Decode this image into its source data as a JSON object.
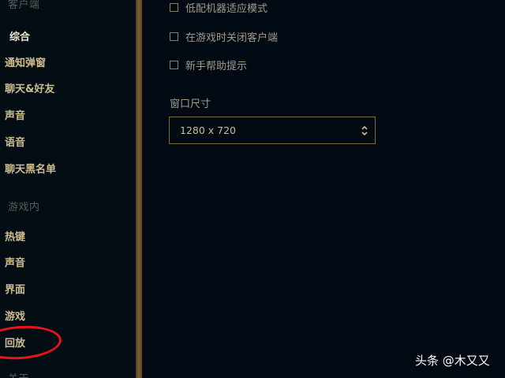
{
  "sidebar": {
    "client_header": "客户端",
    "client_items": [
      {
        "label": "综合",
        "active": true
      },
      {
        "label": "通知弹窗"
      },
      {
        "label": "聊天&好友"
      },
      {
        "label": "声音"
      },
      {
        "label": "语音"
      },
      {
        "label": "聊天黑名单"
      }
    ],
    "ingame_header": "游戏内",
    "ingame_items": [
      {
        "label": "热键"
      },
      {
        "label": "声音"
      },
      {
        "label": "界面"
      },
      {
        "label": "游戏"
      },
      {
        "label": "回放",
        "highlighted": true
      }
    ],
    "about_header": "关于"
  },
  "main": {
    "checkboxes": [
      {
        "label": "低配机器适应模式",
        "checked": false
      },
      {
        "label": "在游戏时关闭客户端",
        "checked": false
      },
      {
        "label": "新手帮助提示",
        "checked": false
      }
    ],
    "window_size": {
      "label": "窗口尺寸",
      "value": "1280 x 720"
    }
  },
  "watermark": {
    "text": "头条 @木又又"
  },
  "colors": {
    "background": "#010a13",
    "gold_text": "#cdbe91",
    "gold_border": "#7d6a41",
    "annotation_red": "#e8141c"
  }
}
